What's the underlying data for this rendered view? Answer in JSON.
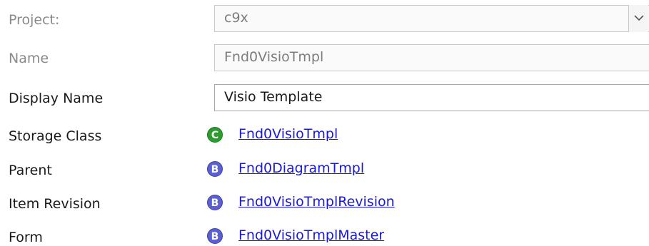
{
  "project": {
    "label": "Project:",
    "value": "c9x"
  },
  "name": {
    "label": "Name",
    "value": "Fnd0VisioTmpl"
  },
  "display_name": {
    "label": "Display Name",
    "value": "Visio Template"
  },
  "storage_class": {
    "label": "Storage Class",
    "badge": "C",
    "link": "Fnd0VisioTmpl"
  },
  "parent": {
    "label": "Parent",
    "badge": "B",
    "link": "Fnd0DiagramTmpl"
  },
  "item_revision": {
    "label": "Item Revision",
    "badge": "B",
    "link": "Fnd0VisioTmplRevision"
  },
  "form": {
    "label": "Form",
    "badge": "B",
    "link": "Fnd0VisioTmplMaster"
  },
  "colors": {
    "class_badge": "#2e9b2e",
    "business_badge": "#5b5fcf",
    "link": "#1a1ad6"
  }
}
